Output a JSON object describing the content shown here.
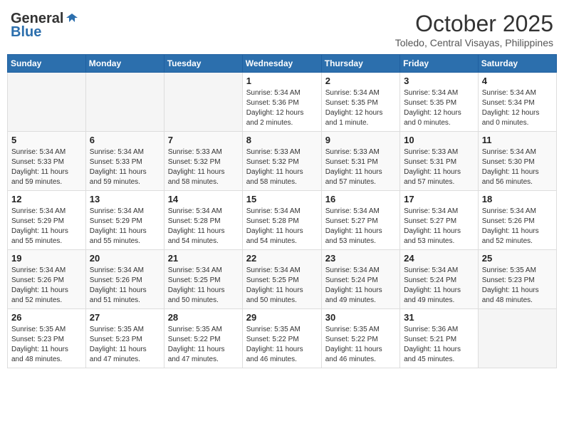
{
  "header": {
    "logo_general": "General",
    "logo_blue": "Blue",
    "month": "October 2025",
    "location": "Toledo, Central Visayas, Philippines"
  },
  "weekdays": [
    "Sunday",
    "Monday",
    "Tuesday",
    "Wednesday",
    "Thursday",
    "Friday",
    "Saturday"
  ],
  "weeks": [
    [
      {
        "day": "",
        "info": ""
      },
      {
        "day": "",
        "info": ""
      },
      {
        "day": "",
        "info": ""
      },
      {
        "day": "1",
        "info": "Sunrise: 5:34 AM\nSunset: 5:36 PM\nDaylight: 12 hours\nand 2 minutes."
      },
      {
        "day": "2",
        "info": "Sunrise: 5:34 AM\nSunset: 5:35 PM\nDaylight: 12 hours\nand 1 minute."
      },
      {
        "day": "3",
        "info": "Sunrise: 5:34 AM\nSunset: 5:35 PM\nDaylight: 12 hours\nand 0 minutes."
      },
      {
        "day": "4",
        "info": "Sunrise: 5:34 AM\nSunset: 5:34 PM\nDaylight: 12 hours\nand 0 minutes."
      }
    ],
    [
      {
        "day": "5",
        "info": "Sunrise: 5:34 AM\nSunset: 5:33 PM\nDaylight: 11 hours\nand 59 minutes."
      },
      {
        "day": "6",
        "info": "Sunrise: 5:34 AM\nSunset: 5:33 PM\nDaylight: 11 hours\nand 59 minutes."
      },
      {
        "day": "7",
        "info": "Sunrise: 5:33 AM\nSunset: 5:32 PM\nDaylight: 11 hours\nand 58 minutes."
      },
      {
        "day": "8",
        "info": "Sunrise: 5:33 AM\nSunset: 5:32 PM\nDaylight: 11 hours\nand 58 minutes."
      },
      {
        "day": "9",
        "info": "Sunrise: 5:33 AM\nSunset: 5:31 PM\nDaylight: 11 hours\nand 57 minutes."
      },
      {
        "day": "10",
        "info": "Sunrise: 5:33 AM\nSunset: 5:31 PM\nDaylight: 11 hours\nand 57 minutes."
      },
      {
        "day": "11",
        "info": "Sunrise: 5:34 AM\nSunset: 5:30 PM\nDaylight: 11 hours\nand 56 minutes."
      }
    ],
    [
      {
        "day": "12",
        "info": "Sunrise: 5:34 AM\nSunset: 5:29 PM\nDaylight: 11 hours\nand 55 minutes."
      },
      {
        "day": "13",
        "info": "Sunrise: 5:34 AM\nSunset: 5:29 PM\nDaylight: 11 hours\nand 55 minutes."
      },
      {
        "day": "14",
        "info": "Sunrise: 5:34 AM\nSunset: 5:28 PM\nDaylight: 11 hours\nand 54 minutes."
      },
      {
        "day": "15",
        "info": "Sunrise: 5:34 AM\nSunset: 5:28 PM\nDaylight: 11 hours\nand 54 minutes."
      },
      {
        "day": "16",
        "info": "Sunrise: 5:34 AM\nSunset: 5:27 PM\nDaylight: 11 hours\nand 53 minutes."
      },
      {
        "day": "17",
        "info": "Sunrise: 5:34 AM\nSunset: 5:27 PM\nDaylight: 11 hours\nand 53 minutes."
      },
      {
        "day": "18",
        "info": "Sunrise: 5:34 AM\nSunset: 5:26 PM\nDaylight: 11 hours\nand 52 minutes."
      }
    ],
    [
      {
        "day": "19",
        "info": "Sunrise: 5:34 AM\nSunset: 5:26 PM\nDaylight: 11 hours\nand 52 minutes."
      },
      {
        "day": "20",
        "info": "Sunrise: 5:34 AM\nSunset: 5:26 PM\nDaylight: 11 hours\nand 51 minutes."
      },
      {
        "day": "21",
        "info": "Sunrise: 5:34 AM\nSunset: 5:25 PM\nDaylight: 11 hours\nand 50 minutes."
      },
      {
        "day": "22",
        "info": "Sunrise: 5:34 AM\nSunset: 5:25 PM\nDaylight: 11 hours\nand 50 minutes."
      },
      {
        "day": "23",
        "info": "Sunrise: 5:34 AM\nSunset: 5:24 PM\nDaylight: 11 hours\nand 49 minutes."
      },
      {
        "day": "24",
        "info": "Sunrise: 5:34 AM\nSunset: 5:24 PM\nDaylight: 11 hours\nand 49 minutes."
      },
      {
        "day": "25",
        "info": "Sunrise: 5:35 AM\nSunset: 5:23 PM\nDaylight: 11 hours\nand 48 minutes."
      }
    ],
    [
      {
        "day": "26",
        "info": "Sunrise: 5:35 AM\nSunset: 5:23 PM\nDaylight: 11 hours\nand 48 minutes."
      },
      {
        "day": "27",
        "info": "Sunrise: 5:35 AM\nSunset: 5:23 PM\nDaylight: 11 hours\nand 47 minutes."
      },
      {
        "day": "28",
        "info": "Sunrise: 5:35 AM\nSunset: 5:22 PM\nDaylight: 11 hours\nand 47 minutes."
      },
      {
        "day": "29",
        "info": "Sunrise: 5:35 AM\nSunset: 5:22 PM\nDaylight: 11 hours\nand 46 minutes."
      },
      {
        "day": "30",
        "info": "Sunrise: 5:35 AM\nSunset: 5:22 PM\nDaylight: 11 hours\nand 46 minutes."
      },
      {
        "day": "31",
        "info": "Sunrise: 5:36 AM\nSunset: 5:21 PM\nDaylight: 11 hours\nand 45 minutes."
      },
      {
        "day": "",
        "info": ""
      }
    ]
  ]
}
